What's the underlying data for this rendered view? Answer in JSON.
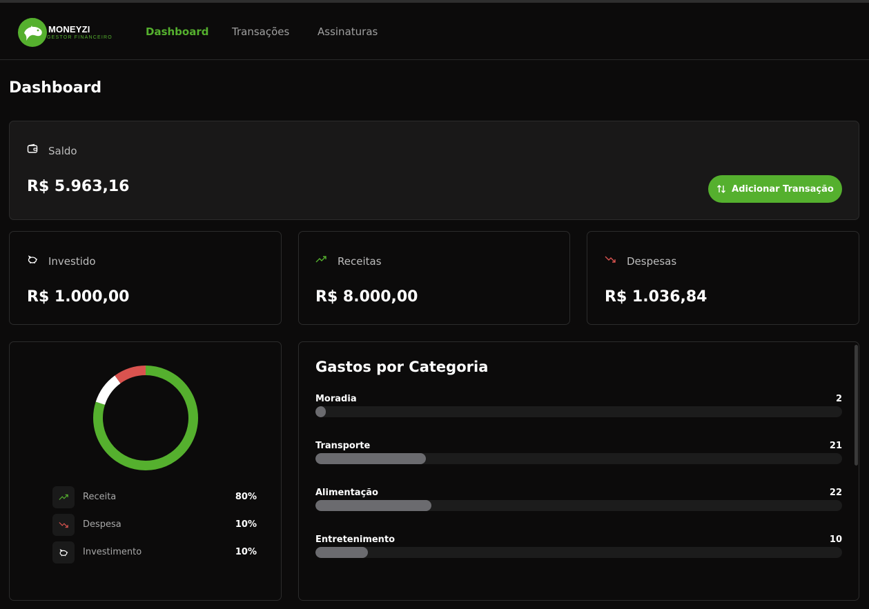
{
  "app": {
    "brand": "MONEYZI",
    "tagline": "GESTOR FINANCEIRO",
    "accent_color": "#55b02e"
  },
  "nav": {
    "items": [
      {
        "label": "Dashboard",
        "active": true
      },
      {
        "label": "Transações",
        "active": false
      },
      {
        "label": "Assinaturas",
        "active": false
      }
    ]
  },
  "page": {
    "title": "Dashboard"
  },
  "balance": {
    "label": "Saldo",
    "value": "R$ 5.963,16",
    "icon": "wallet-icon",
    "add_button_label": "Adicionar Transação",
    "add_button_icon": "arrows-up-down-icon"
  },
  "summary_cards": [
    {
      "label": "Investido",
      "value": "R$ 1.000,00",
      "icon": "piggy-bank-icon"
    },
    {
      "label": "Receitas",
      "value": "R$ 8.000,00",
      "icon": "trending-up-icon"
    },
    {
      "label": "Despesas",
      "value": "R$ 1.036,84",
      "icon": "trending-down-icon"
    }
  ],
  "chart_data": {
    "type": "pie",
    "donut": true,
    "slices": [
      {
        "label": "Receita",
        "value": 80,
        "color": "#55b02e"
      },
      {
        "label": "Despesa",
        "value": 10,
        "color": "#d9534f"
      },
      {
        "label": "Investimento",
        "value": 10,
        "color": "#ffffff"
      }
    ]
  },
  "legend": [
    {
      "label": "Receita",
      "percent": "80%",
      "icon": "trending-up-icon"
    },
    {
      "label": "Despesa",
      "percent": "10%",
      "icon": "trending-down-icon"
    },
    {
      "label": "Investimento",
      "percent": "10%",
      "icon": "piggy-bank-icon"
    }
  ],
  "categories": {
    "title": "Gastos por Categoria",
    "items": [
      {
        "name": "Moradia",
        "count": "2",
        "fill": 0.02
      },
      {
        "name": "Transporte",
        "count": "21",
        "fill": 0.21
      },
      {
        "name": "Alimentação",
        "count": "22",
        "fill": 0.22
      },
      {
        "name": "Entretenimento",
        "count": "10",
        "fill": 0.1
      }
    ]
  },
  "colors": {
    "background": "#0c0b0b",
    "card_dark": "#191818",
    "expense_red": "#d9534f",
    "bar_fill": "#6b6b6f"
  }
}
